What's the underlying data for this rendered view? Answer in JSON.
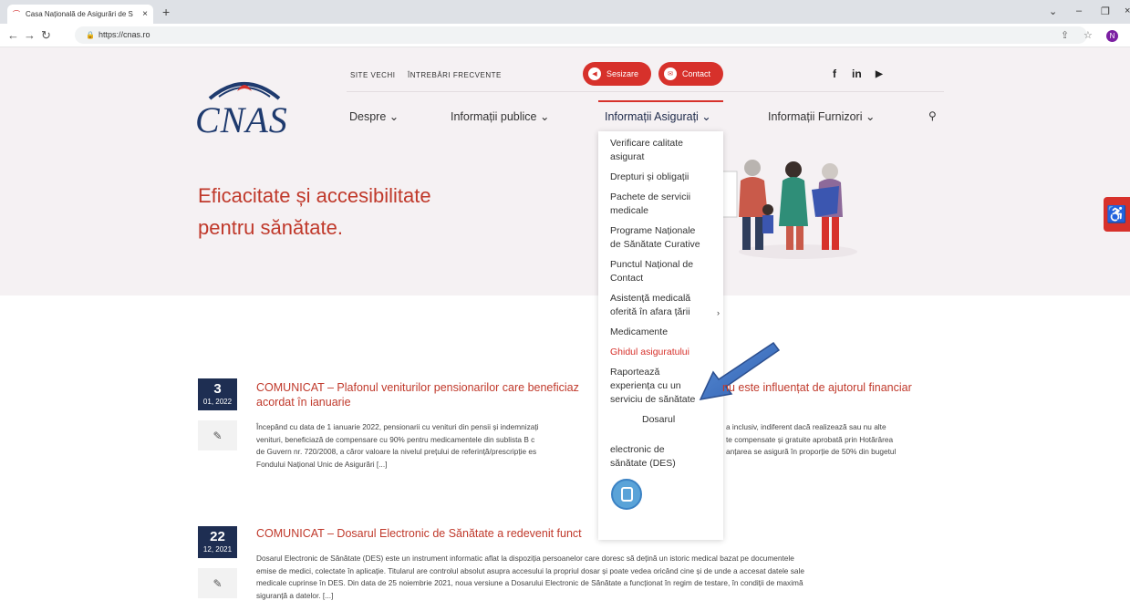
{
  "browser": {
    "tab_title": "Casa Națională de Asigurări de S",
    "tab_close": "×",
    "new_tab": "+",
    "url": "https://cnas.ro",
    "profile_initial": "N"
  },
  "logo": {
    "text": "CNAS"
  },
  "topbar": {
    "links": [
      "SITE VECHI",
      "ÎNTREBĂRI FRECVENTE"
    ],
    "sesizare": "Sesizare",
    "contact": "Contact",
    "social": [
      "f",
      "in",
      "▶"
    ]
  },
  "nav": {
    "items": [
      "Despre ⌄",
      "Informații publice ⌄",
      "Informații Asigurați ⌄",
      "Informații Furnizori ⌄"
    ]
  },
  "hero": {
    "title_line1": "Eficacitate și accesibilitate",
    "title_line2": "pentru sănătate."
  },
  "dropdown": {
    "items": [
      "Verificare calitate asigurat",
      "Drepturi și obligații",
      "Pachete de servicii medicale",
      "Programe Naționale de Sănătate Curative",
      "Punctul Național de Contact",
      "Asistență medicală oferită în afara țării",
      "Medicamente",
      "Ghidul asiguratului",
      "Raportează experiența cu un serviciu de sănătate"
    ],
    "des_label_1": "Dosarul",
    "des_label_2": "electronic de sănătate (DES)",
    "highlight_color": "#d7312b"
  },
  "news": [
    {
      "day": "3",
      "month_year": "01, 2022",
      "title_a": "COMUNICAT – Plafonul veniturilor pensionarilor care beneficiaz",
      "title_b": "nu este influențat de ajutorul financiar",
      "title_line2": "acordat în ianuarie",
      "body": [
        "Începând cu data de 1 ianuarie 2022, pensionarii cu venituri din pensii și indemnizați",
        "venituri, beneficiază de compensare cu 90% pentru medicamentele din sublista B c",
        "de Guvern nr. 720/2008, a căror valoare la nivelul prețului de referință/prescripție es",
        "Fondului Național Unic de Asigurări [...]"
      ],
      "body_right": [
        "a inclusiv, indiferent dacă realizează sau nu alte",
        "te compensate și gratuite aprobată prin Hotărârea",
        "anțarea se asigură în proporție de 50% din bugetul"
      ]
    },
    {
      "day": "22",
      "month_year": "12, 2021",
      "title_a": "COMUNICAT – Dosarul Electronic de Sănătate a redevenit funct",
      "body": [
        "Dosarul Electronic de Sănătate (DES) este un instrument informatic aflat la dispoziția persoanelor care doresc să dețină un istoric medical bazat pe documentele",
        "emise de medici, colectate în aplicație. Titularul are controlul absolut asupra accesului la propriul dosar și poate vedea oricând cine și de unde a accesat datele sale",
        "medicale cuprinse în DES. Din data de 25 noiembrie 2021, noua versiune a Dosarului Electronic de Sănătate a funcționat în regim de testare, în condiții de maximă",
        "siguranță a datelor. [...]"
      ]
    }
  ],
  "accessibility_icon": "wheelchair-icon"
}
